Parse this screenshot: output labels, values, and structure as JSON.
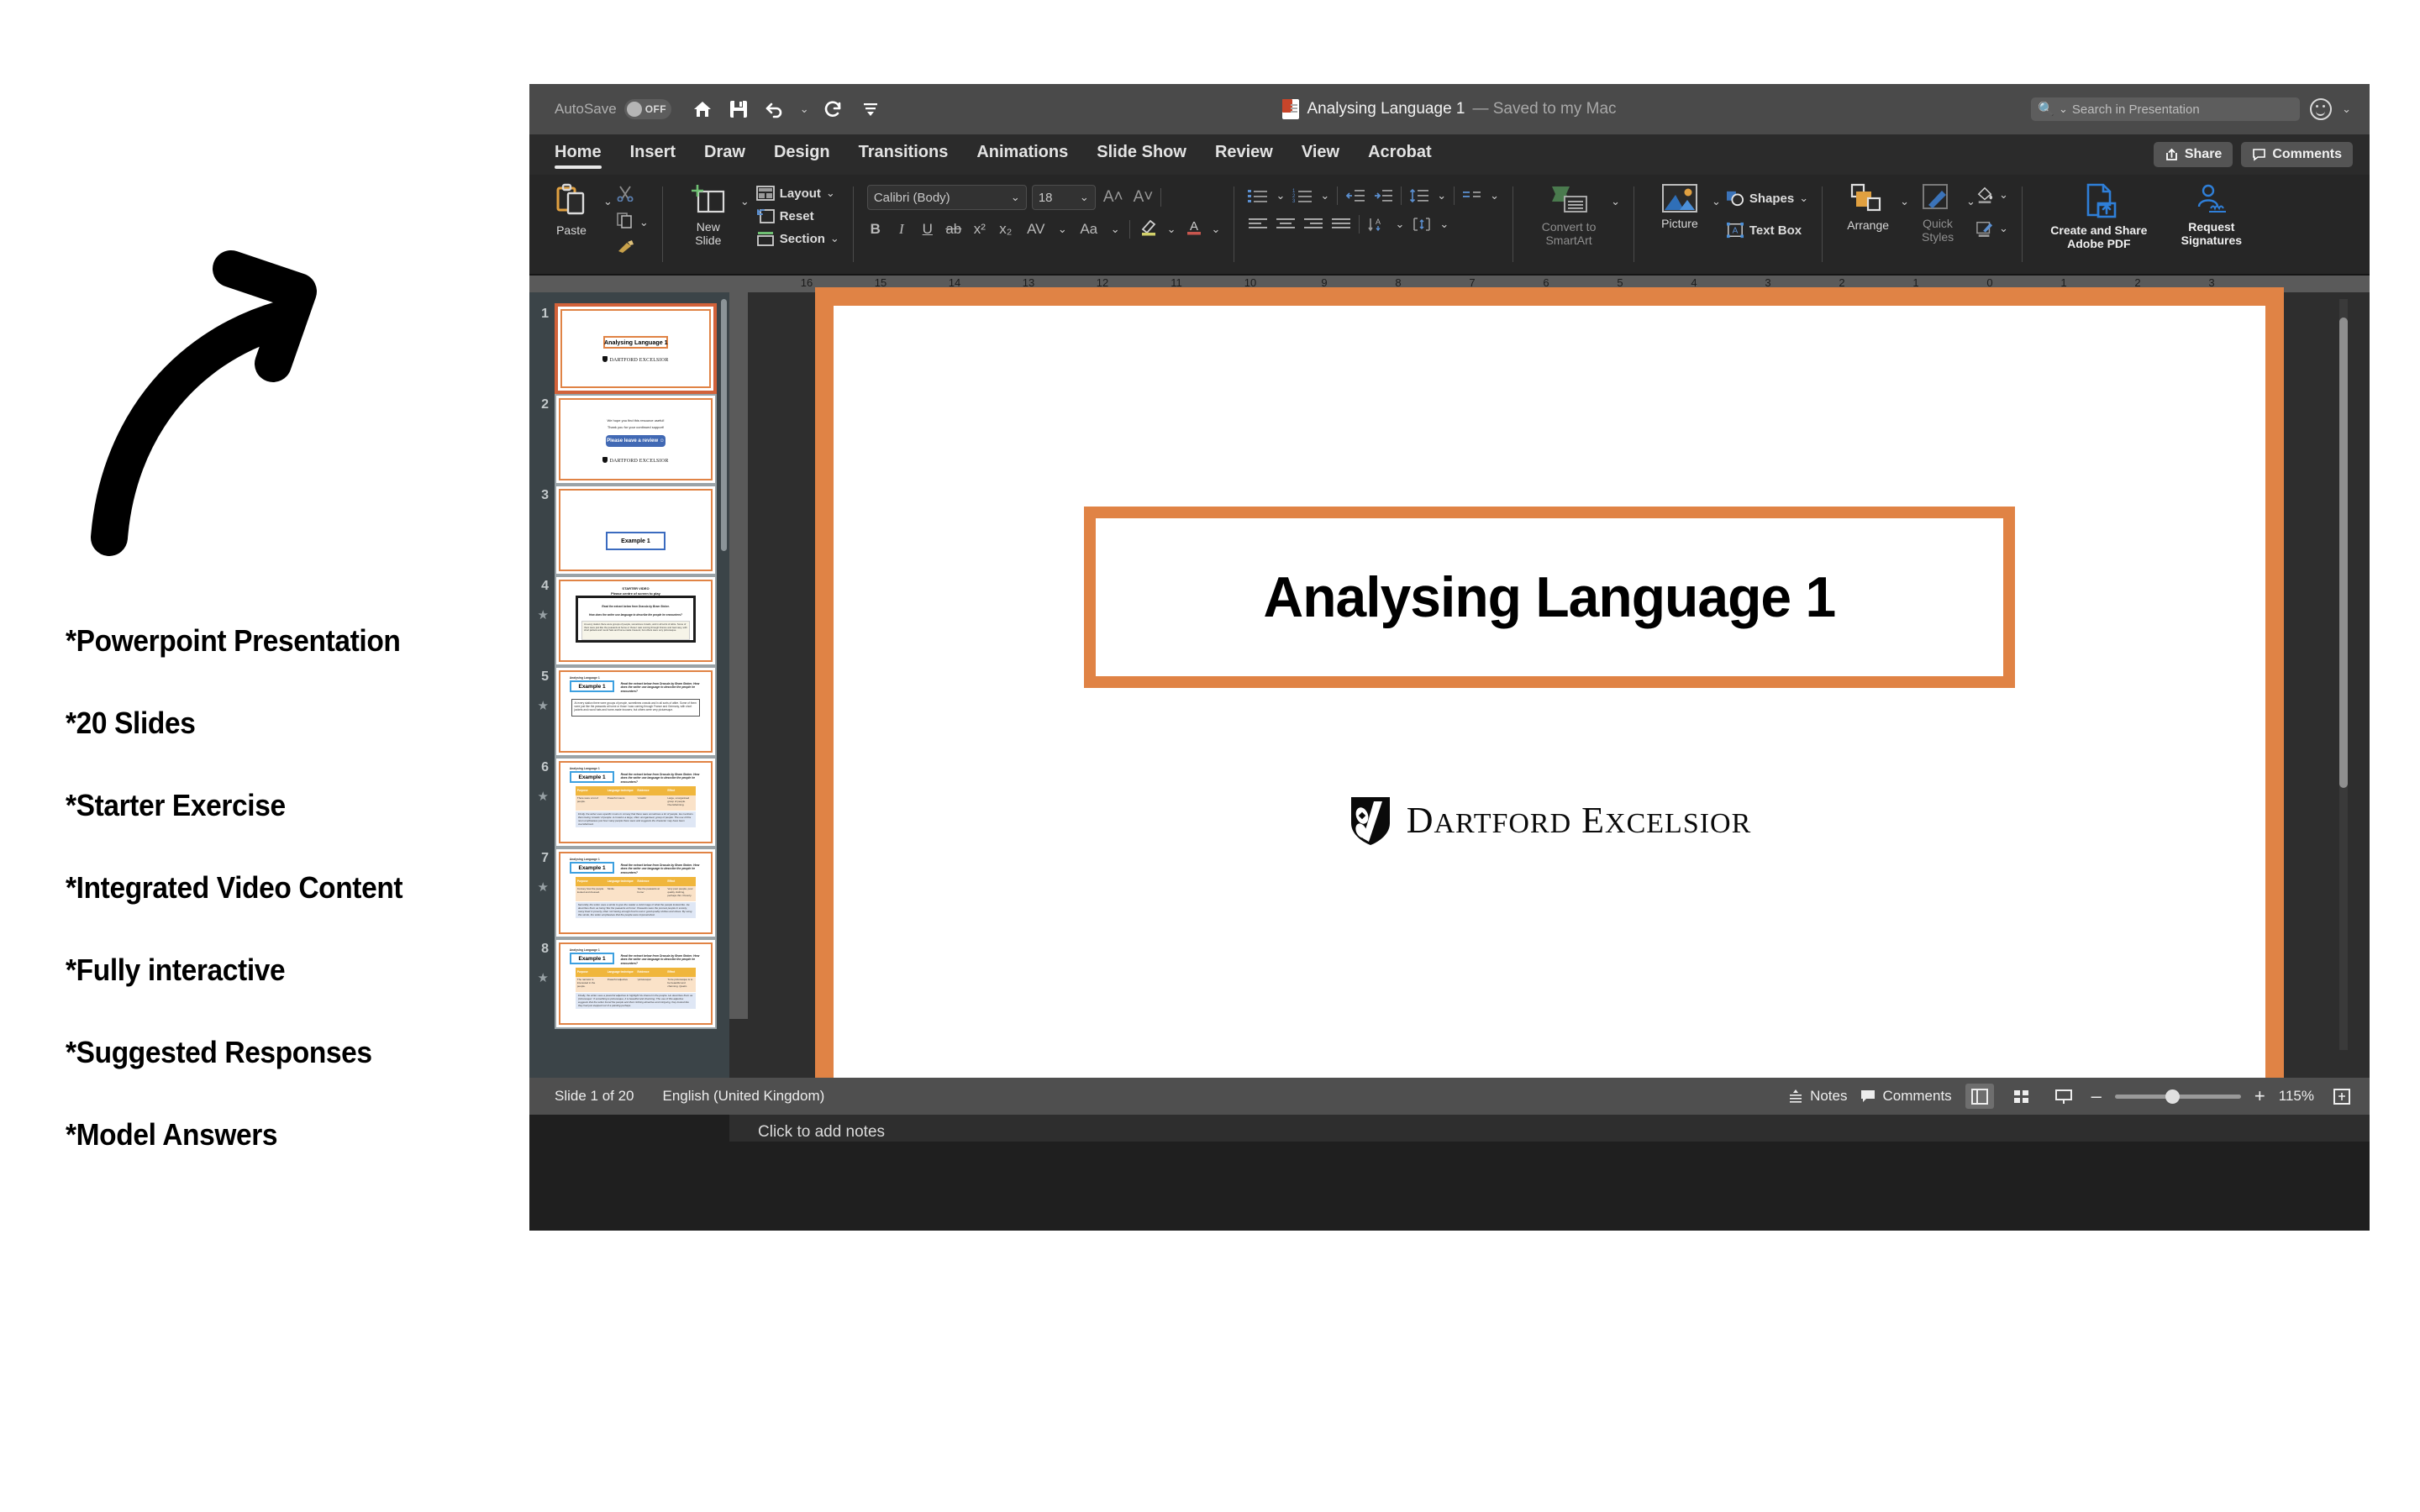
{
  "promo": {
    "bullets": [
      "*Powerpoint Presentation",
      "*20 Slides",
      "*Starter Exercise",
      "*Integrated Video Content",
      "*Fully interactive",
      "*Suggested Responses",
      "*Model Answers"
    ]
  },
  "titlebar": {
    "autosave_label": "AutoSave",
    "autosave_state": "OFF",
    "doc_title": "Analysing Language 1",
    "doc_subtitle": "— Saved to my Mac",
    "search_placeholder": "Search in Presentation",
    "icons": [
      "home-icon",
      "save-icon",
      "undo-icon",
      "redo-icon",
      "customize-toolbar-icon",
      "smiley-icon"
    ]
  },
  "tabs": [
    {
      "label": "Home",
      "active": true
    },
    {
      "label": "Insert",
      "active": false
    },
    {
      "label": "Draw",
      "active": false
    },
    {
      "label": "Design",
      "active": false
    },
    {
      "label": "Transitions",
      "active": false
    },
    {
      "label": "Animations",
      "active": false
    },
    {
      "label": "Slide Show",
      "active": false
    },
    {
      "label": "Review",
      "active": false
    },
    {
      "label": "View",
      "active": false
    },
    {
      "label": "Acrobat",
      "active": false
    }
  ],
  "tab_actions": {
    "share": "Share",
    "comments": "Comments"
  },
  "ribbon": {
    "paste": "Paste",
    "new_slide": "New\nSlide",
    "new_slide_l1": "New",
    "new_slide_l2": "Slide",
    "layout": "Layout",
    "reset": "Reset",
    "section": "Section",
    "font_name": "Calibri (Body)",
    "font_size": "18",
    "convert_l1": "Convert to",
    "convert_l2": "SmartArt",
    "picture": "Picture",
    "shapes": "Shapes",
    "text_box": "Text Box",
    "arrange": "Arrange",
    "quick_l1": "Quick",
    "quick_l2": "Styles",
    "pdf_l1": "Create and Share",
    "pdf_l2": "Adobe PDF",
    "sign_l1": "Request",
    "sign_l2": "Signatures"
  },
  "ruler": {
    "numbers": [
      "0",
      "1",
      "2",
      "3",
      "4",
      "5",
      "6",
      "7",
      "8",
      "9",
      "10",
      "11",
      "12",
      "13",
      "14",
      "15",
      "16"
    ]
  },
  "thumbnails": [
    {
      "num": "1",
      "selected": true,
      "star": false,
      "kind": "title",
      "title": "Analysing Language 1",
      "logo": "DARTFORD EXCELSIOR"
    },
    {
      "num": "2",
      "selected": false,
      "star": false,
      "kind": "review",
      "line1": "We hope you find this resource useful!",
      "line2": "Thank you for your continued support!",
      "button": "Please leave a review ☺",
      "logo": "DARTFORD EXCELSIOR"
    },
    {
      "num": "3",
      "selected": false,
      "star": false,
      "kind": "example",
      "title": "Example 1"
    },
    {
      "num": "4",
      "selected": false,
      "star": true,
      "kind": "video",
      "title_l1": "STARTER VIDEO",
      "title_l2": "Please centre of screen to play",
      "q1": "Read the extract below from Dracula by Bram Stoker.",
      "q2": "How does the writer use language to describe the people he encounters?",
      "extract": "At every station there were groups of people, sometimes crowds, and in all sorts of attire. Some of them were just like the peasants at home or those I saw coming through France and Germany, with short jackets and round hats and home-made trousers; but others were very picturesque."
    },
    {
      "num": "5",
      "selected": false,
      "star": true,
      "kind": "extract",
      "header": "Analysing Language 1",
      "example": "Example 1",
      "question": "Read the extract below from Dracula by Bram Stoker. How does the writer use language to describe the people he encounters?",
      "extract": "At every station there were groups of people, sometimes crowds and in all sorts of attire. Some of them were just like the peasants at home or those I saw coming through France and Germany, with short jackets and round hats and home-made trousers; but others were very picturesque."
    },
    {
      "num": "6",
      "selected": false,
      "star": true,
      "kind": "table",
      "header": "Analysing Language 1",
      "example": "Example 1",
      "question": "Read the extract below from Dracula by Bram Stoker. How does the writer use language to describe the people he encounters?",
      "columns": [
        "Purpose",
        "Language technique",
        "Evidence",
        "Effect"
      ],
      "row": [
        "There were a lot of people.",
        "Powerful nouns",
        "'crowds'",
        "Large, unorganised group of people. Overwhelming."
      ],
      "note": "Firstly, the writer uses specific nouns to convey that there were sometimes a lot of people. He mentions them being 'crowds' of people. A crowd is a large, often unorganised, group of people. The use of this noun emphasises just how many people there were and suggests the character may have been overwhelmed."
    },
    {
      "num": "7",
      "selected": false,
      "star": true,
      "kind": "table",
      "header": "Analysing Language 1",
      "example": "Example 1",
      "question": "Read the extract below from Dracula by Bram Stoker. How does the writer use language to describe the people he encounters?",
      "columns": [
        "Purpose",
        "Language technique",
        "Evidence",
        "Effect"
      ],
      "row": [
        "Convey how the people looked and dressed.",
        "Simile",
        "'like the peasants at home'",
        "Very poor people, poor quality clothing, perhaps thin. Poverty."
      ],
      "note": "Secondly, the writer uses a simile to give the reader a vivid image of what the people looked like. He describes them as being 'like the peasants at home'. Peasants were the poorest people in society, many lived in poverty, often not having enough food to eat or good quality clothes and shoes. By using this simile, the writer emphasises that the people were impoverished."
    },
    {
      "num": "8",
      "selected": false,
      "star": true,
      "kind": "table",
      "header": "Analysing Language 1",
      "example": "Example 1",
      "question": "Read the extract below from Dracula by Bram Stoker. How does the writer use language to describe the people he encounters?",
      "columns": [
        "Purpose",
        "Language technique",
        "Evidence",
        "Effect"
      ],
      "row": [
        "The narrator is interested in the people.",
        "Powerful adjective",
        "'picturesque'",
        "To be picturesque is to be beautiful and charming. Quaint."
      ],
      "note": "Finally, the writer uses a powerful adjective to highlight his interest in the people. He describes them as 'picturesque'. If something is picturesque, it is beautiful and charming. The use of this adjective suggests that the writer found the people and their clothing attractive and intriguing, they looked like they had just stepped out of a painting perhaps."
    }
  ],
  "slide": {
    "title": "Analysing Language 1",
    "logo_text": "DARTFORD EXCELSIOR",
    "logo_d": "D",
    "logo_artford": "ARTFORD",
    "logo_e": "E",
    "logo_xcelsior": "XCELSIOR",
    "accent_color": "#e08345"
  },
  "notes": {
    "placeholder": "Click to add notes"
  },
  "statusbar": {
    "slide_counter": "Slide 1 of 20",
    "language": "English (United Kingdom)",
    "notes_label": "Notes",
    "comments_label": "Comments",
    "zoom_level": "115%",
    "zoom_out": "–",
    "zoom_in": "+"
  }
}
